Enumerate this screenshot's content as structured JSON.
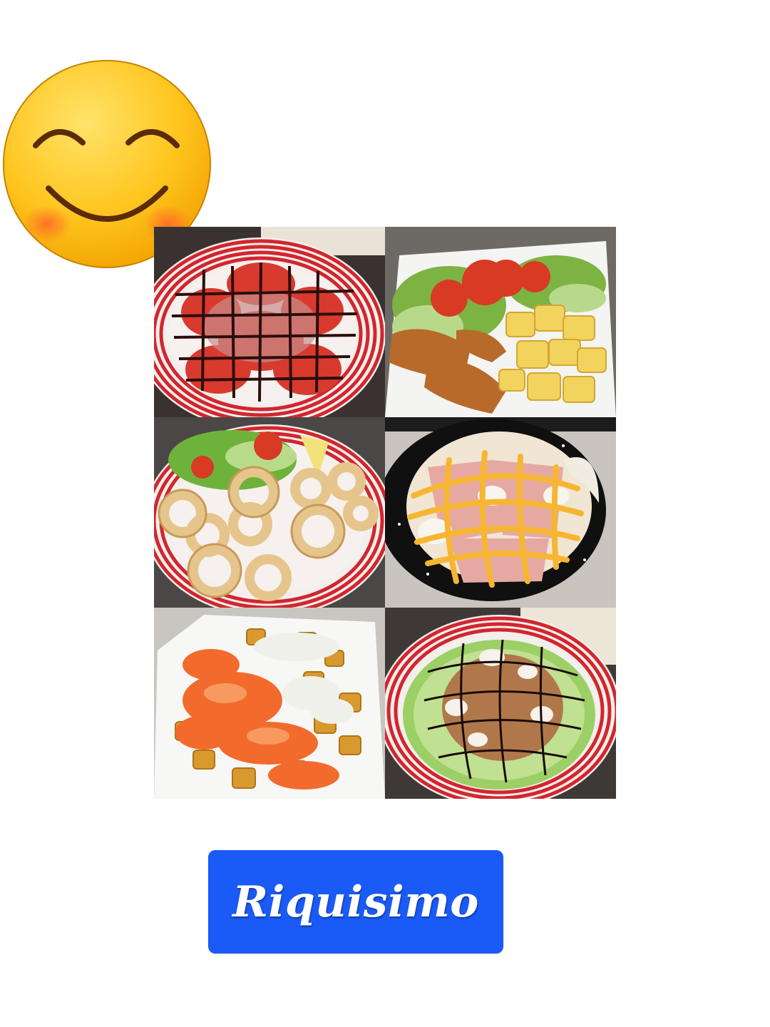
{
  "emoji": {
    "icon": "smiling-face-icon"
  },
  "photos": [
    {
      "name": "tomato-carpaccio-photo",
      "icon": "food-photo"
    },
    {
      "name": "breaded-fillets-fries-photo",
      "icon": "food-photo"
    },
    {
      "name": "fried-calamari-salad-photo",
      "icon": "food-photo"
    },
    {
      "name": "ham-egg-pan-photo",
      "icon": "food-photo"
    },
    {
      "name": "patatas-bravas-photo",
      "icon": "food-photo"
    },
    {
      "name": "crispy-salad-photo",
      "icon": "food-photo"
    }
  ],
  "badge": {
    "label": "Riquisimo",
    "color": "#1a5af7"
  }
}
